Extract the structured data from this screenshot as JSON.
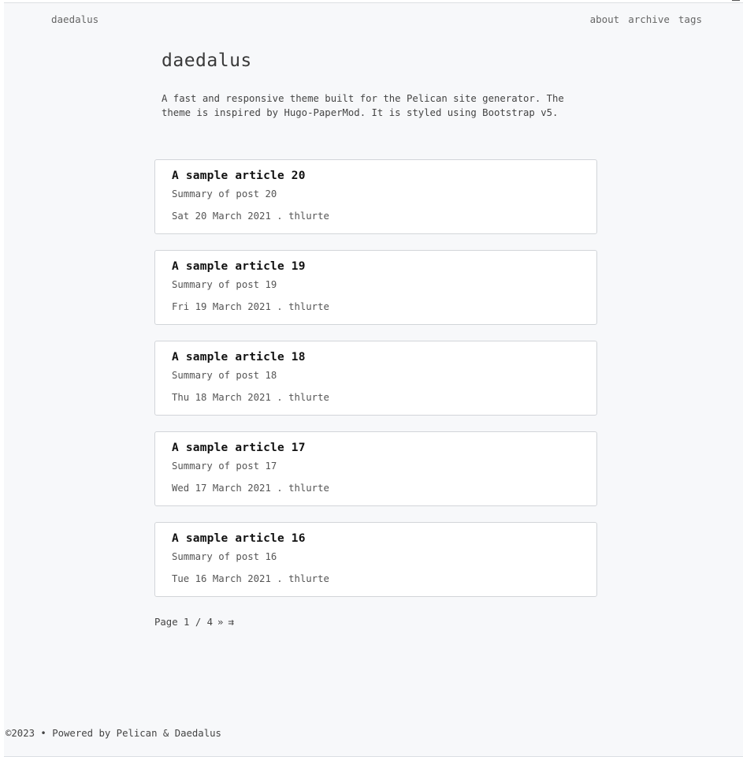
{
  "nav": {
    "brand": "daedalus",
    "links": [
      "about",
      "archive",
      "tags"
    ]
  },
  "header": {
    "title": "daedalus",
    "description": "A fast and responsive theme built for the Pelican site generator. The theme is inspired by Hugo-PaperMod. It is styled using Bootstrap v5."
  },
  "posts": [
    {
      "title": "A sample article 20",
      "summary": "Summary of post 20",
      "meta": "Sat 20 March 2021 . thlurte"
    },
    {
      "title": "A sample article 19",
      "summary": "Summary of post 19",
      "meta": "Fri 19 March 2021 . thlurte"
    },
    {
      "title": "A sample article 18",
      "summary": "Summary of post 18",
      "meta": "Thu 18 March 2021 . thlurte"
    },
    {
      "title": "A sample article 17",
      "summary": "Summary of post 17",
      "meta": "Wed 17 March 2021 . thlurte"
    },
    {
      "title": "A sample article 16",
      "summary": "Summary of post 16",
      "meta": "Tue 16 March 2021 . thlurte"
    }
  ],
  "pagination": {
    "label": "Page 1 / 4",
    "next": "»",
    "last": "⇉"
  },
  "footer": {
    "text": "©2023 • Powered by Pelican & Daedalus"
  }
}
